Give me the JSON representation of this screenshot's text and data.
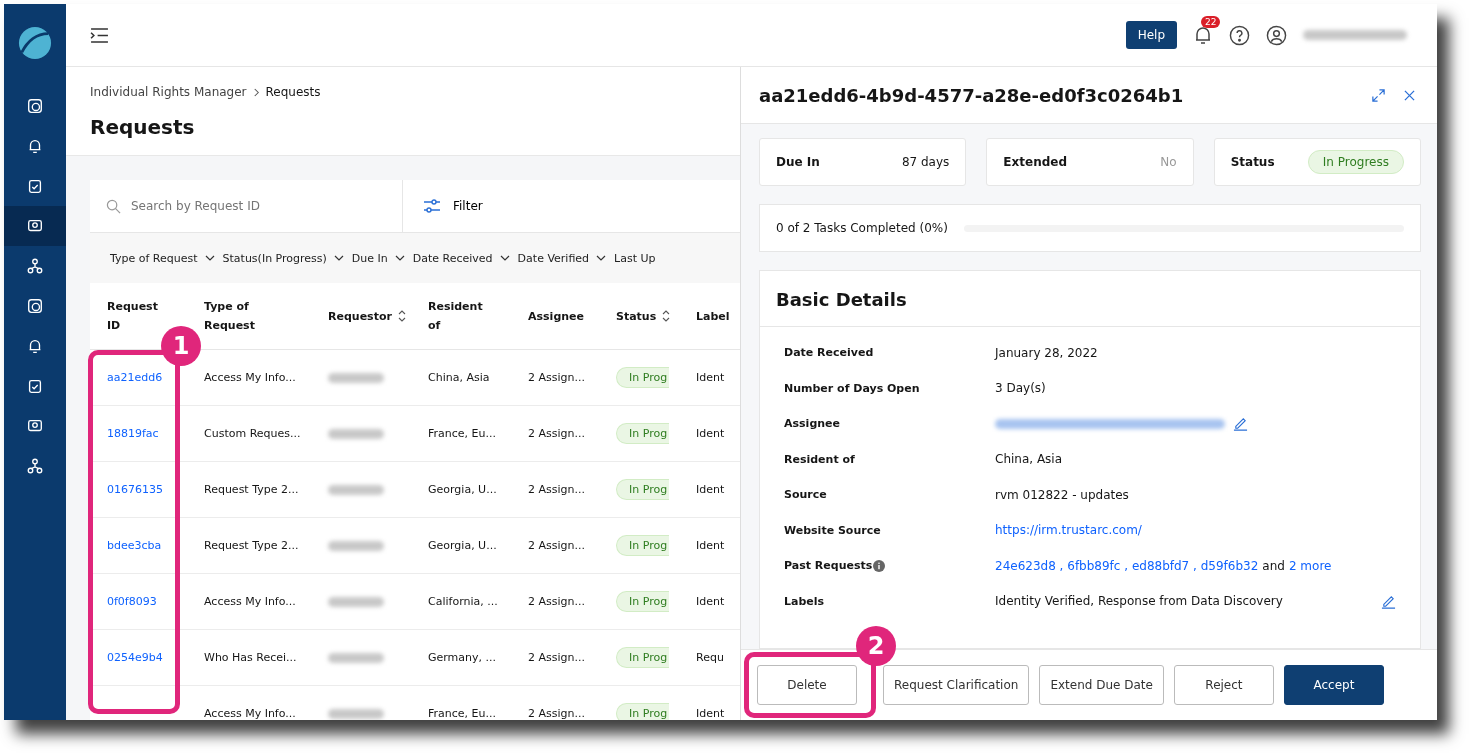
{
  "topbar": {
    "help_button": "Help",
    "notification_count": "22"
  },
  "sidebar": {
    "items": [
      {
        "selected": false
      },
      {
        "selected": false
      },
      {
        "selected": false
      },
      {
        "selected": true
      },
      {
        "selected": false
      },
      {
        "selected": false
      },
      {
        "selected": false
      },
      {
        "selected": false
      },
      {
        "selected": false
      },
      {
        "selected": false
      }
    ]
  },
  "breadcrumb": [
    "Individual Rights Manager",
    "Requests"
  ],
  "page_title": "Requests",
  "search": {
    "placeholder": "Search by Request ID"
  },
  "filter_button": "Filter",
  "filter_chips": [
    "Type of Request",
    "Status(In Progress)",
    "Due In",
    "Date Received",
    "Date Verified",
    "Last Up"
  ],
  "table": {
    "columns": [
      {
        "label": "Request ID",
        "sortable": false
      },
      {
        "label": "Type of Request",
        "sortable": false
      },
      {
        "label": "Requestor",
        "sortable": true
      },
      {
        "label": "Resident of",
        "sortable": false
      },
      {
        "label": "Assignee",
        "sortable": false
      },
      {
        "label": "Status",
        "sortable": true
      },
      {
        "label": "Label",
        "sortable": false
      }
    ],
    "rows": [
      {
        "id": "aa21edd6",
        "type": "Access My Info...",
        "resident": "China, Asia",
        "assignee": "2 Assign...",
        "status": "In Prog",
        "label": "Ident"
      },
      {
        "id": "18819fac",
        "type": "Custom Reques...",
        "resident": "France, Eu...",
        "assignee": "2 Assign...",
        "status": "In Prog",
        "label": "Ident"
      },
      {
        "id": "01676135",
        "type": "Request Type 2...",
        "resident": "Georgia, U...",
        "assignee": "2 Assign...",
        "status": "In Prog",
        "label": "Ident"
      },
      {
        "id": "bdee3cba",
        "type": "Request Type 2...",
        "resident": "Georgia, U...",
        "assignee": "2 Assign...",
        "status": "In Prog",
        "label": "Ident"
      },
      {
        "id": "0f0f8093",
        "type": "Access My Info...",
        "resident": "California, ...",
        "assignee": "2 Assign...",
        "status": "In Prog",
        "label": "Ident"
      },
      {
        "id": "0254e9b4",
        "type": "Who Has Recei...",
        "resident": "Germany, ...",
        "assignee": "2 Assign...",
        "status": "In Prog",
        "label": "Requ"
      },
      {
        "type": "Access My Info...",
        "resident": "France, Eu...",
        "assignee": "2 Assign...",
        "status": "In Prog",
        "label": "Ident"
      }
    ]
  },
  "panel": {
    "title": "aa21edd6-4b9d-4577-a28e-ed0f3c0264b1",
    "due_in": {
      "label": "Due In",
      "value": "87 days"
    },
    "extended": {
      "label": "Extended",
      "value": "No"
    },
    "status": {
      "label": "Status",
      "value": "In Progress"
    },
    "tasks": {
      "text": "0 of 2 Tasks Completed (0%)",
      "level": 0
    },
    "section_title": "Basic Details",
    "details": [
      {
        "kind": "text",
        "label": "Date Received",
        "value": "January 28, 2022"
      },
      {
        "kind": "text",
        "label": "Number of Days Open",
        "value": "3 Day(s)"
      },
      {
        "kind": "hidden",
        "label": "Assignee",
        "editable": true
      },
      {
        "kind": "text",
        "label": "Resident of",
        "value": "China, Asia"
      },
      {
        "kind": "text",
        "label": "Source",
        "value": "rvm 012822 - updates"
      },
      {
        "kind": "link",
        "label": "Website Source",
        "value": "https://irm.trustarc.com/"
      },
      {
        "kind": "links",
        "label": "Past Requests",
        "info": true,
        "links": [
          "24e623d8 , 6fbb89fc , ed88bfd7 , d59f6b32"
        ],
        "joiner": "and",
        "more": "2 more"
      },
      {
        "kind": "text",
        "label": "Labels",
        "value": "Identity Verified, Response from Data Discovery",
        "editable": true
      }
    ],
    "buttons": [
      {
        "label": "Delete",
        "primary": false
      },
      {
        "label": "Request Clarification",
        "primary": false
      },
      {
        "label": "Extend Due Date",
        "primary": false
      },
      {
        "label": "Reject",
        "primary": false
      },
      {
        "label": "Accept",
        "primary": true
      }
    ]
  },
  "annotations": [
    "1",
    "2"
  ]
}
